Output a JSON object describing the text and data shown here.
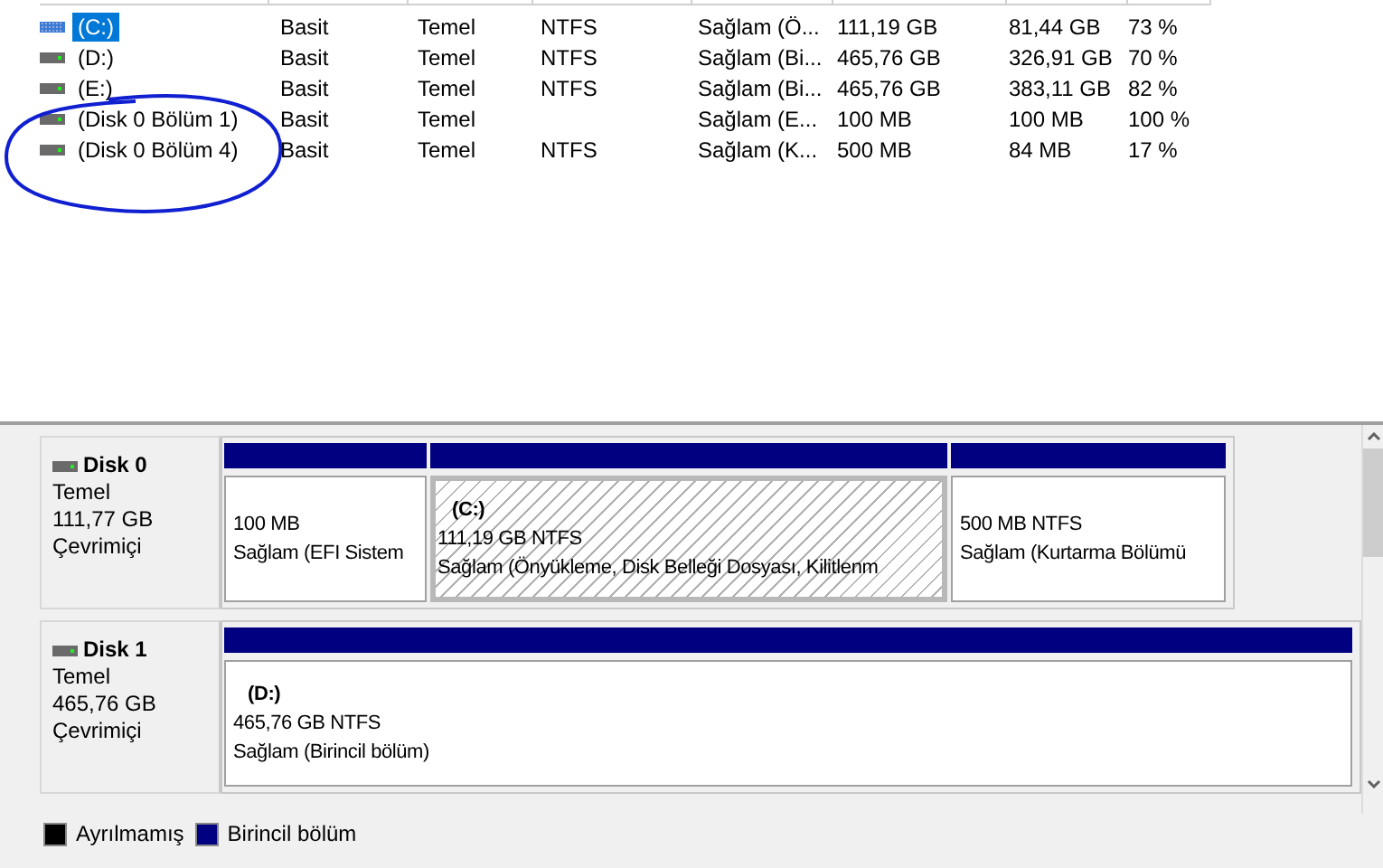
{
  "volumes": [
    {
      "name": "(C:)",
      "kind": "system",
      "selected": true,
      "layout": "Basit",
      "type": "Temel",
      "filesystem": "NTFS",
      "status": "Sağlam (Ö...",
      "capacity": "111,19 GB",
      "free": "81,44 GB",
      "free_pct": "73 %"
    },
    {
      "name": "(D:)",
      "kind": "drive",
      "selected": false,
      "layout": "Basit",
      "type": "Temel",
      "filesystem": "NTFS",
      "status": "Sağlam (Bi...",
      "capacity": "465,76 GB",
      "free": "326,91 GB",
      "free_pct": "70 %"
    },
    {
      "name": "(E:)",
      "kind": "drive",
      "selected": false,
      "layout": "Basit",
      "type": "Temel",
      "filesystem": "NTFS",
      "status": "Sağlam (Bi...",
      "capacity": "465,76 GB",
      "free": "383,11 GB",
      "free_pct": "82 %"
    },
    {
      "name": "(Disk 0 Bölüm 1)",
      "kind": "drive",
      "selected": false,
      "layout": "Basit",
      "type": "Temel",
      "status": "Sağlam (E...",
      "capacity": "100 MB",
      "free": "100 MB",
      "free_pct": "100 %"
    },
    {
      "name": "(Disk 0 Bölüm 4)",
      "kind": "drive",
      "selected": false,
      "layout": "Basit",
      "type": "Temel",
      "filesystem": "NTFS",
      "status": "Sağlam (K...",
      "capacity": "500 MB",
      "free": "84 MB",
      "free_pct": "17 %"
    }
  ],
  "disks": [
    {
      "name": "Disk 0",
      "type": "Temel",
      "size": "111,77 GB",
      "status": "Çevrimiçi",
      "partitions": [
        {
          "size": "100 MB",
          "status": "Sağlam (EFI Sistem",
          "selected": false
        },
        {
          "title": "(C:)",
          "size": "111,19 GB NTFS",
          "status": "Sağlam (Önyükleme, Disk Belleği Dosyası, Kilitlenm",
          "selected": true
        },
        {
          "size": "500 MB NTFS",
          "status": "Sağlam (Kurtarma Bölümü",
          "selected": false
        }
      ]
    },
    {
      "name": "Disk 1",
      "type": "Temel",
      "size": "465,76 GB",
      "status": "Çevrimiçi",
      "partitions": [
        {
          "title": "(D:)",
          "size": "465,76 GB NTFS",
          "status": "Sağlam (Birincil bölüm)",
          "selected": false
        }
      ]
    }
  ],
  "legend": [
    {
      "label": "Ayrılmamış",
      "color": "#000000"
    },
    {
      "label": "Birincil bölüm",
      "color": "#000080"
    }
  ]
}
